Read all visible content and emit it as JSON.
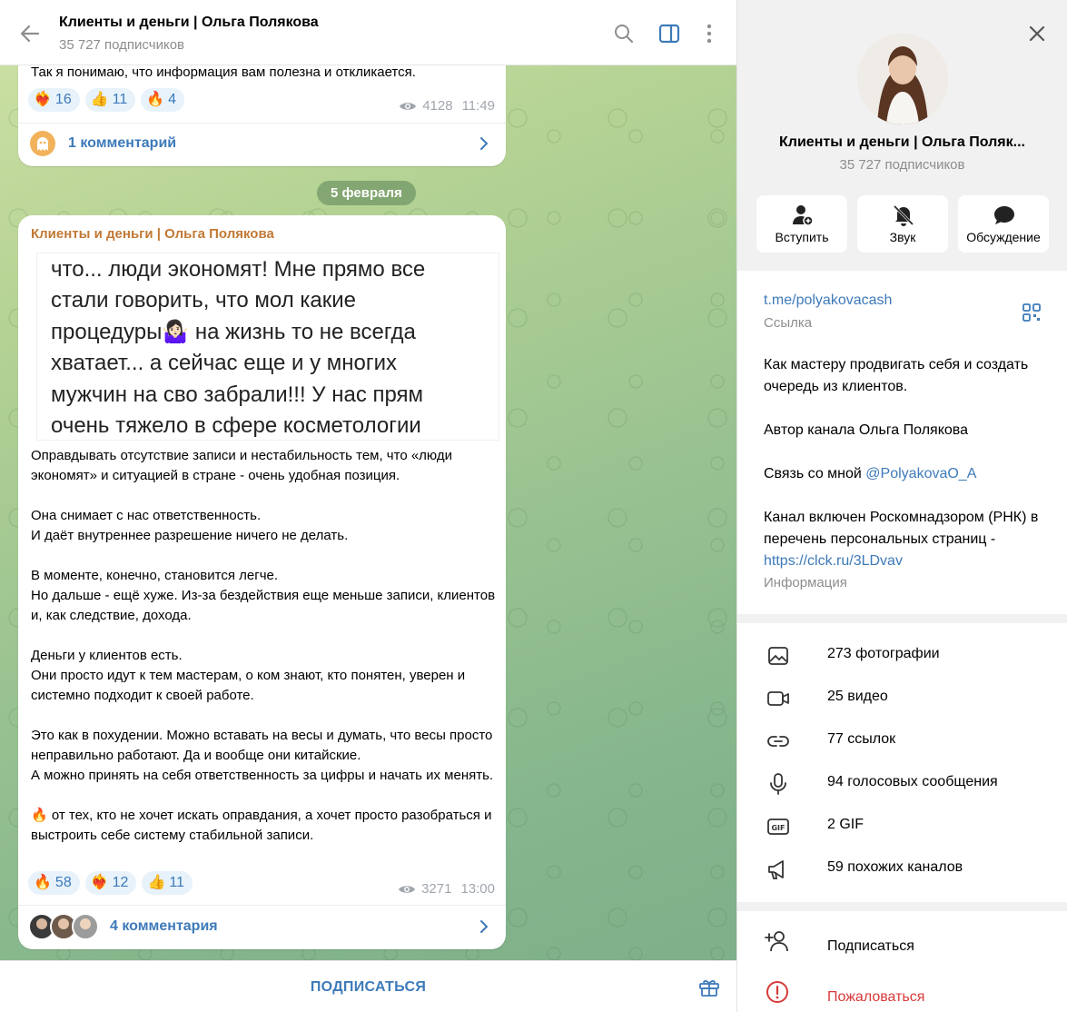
{
  "chat": {
    "header": {
      "title": "Клиенты и деньги | Ольга Полякова",
      "subtitle": "35 727 подписчиков"
    },
    "msg1": {
      "text_tail": "Так я понимаю, что информация вам полезна и откликается.",
      "reactions": [
        {
          "emoji": "❤️‍🔥",
          "count": "16"
        },
        {
          "emoji": "👍",
          "count": "11"
        },
        {
          "emoji": "🔥",
          "count": "4"
        }
      ],
      "views": "4128",
      "time": "11:49",
      "comments_label": "1 комментарий"
    },
    "date_chip": "5 февраля",
    "msg2": {
      "sender": "Клиенты и деньги | Ольга Полякова",
      "image_quote": "что... люди экономят! Мне прямо все\nстали говорить, что мол какие\nпроцедуры🤷🏻‍♀️ на жизнь то не всегда\nхватает... а сейчас еще и у многих\nмужчин на сво забрали!!! У нас прям\nочень тяжело в сфере косметологии",
      "text": "Оправдывать отсутствие записи и нестабильность тем, что «люди экономят» и ситуацией в стране - очень удобная позиция.\n\nОна снимает с нас ответственность.\nИ даёт внутреннее разрешение ничего не делать.\n\nВ моменте, конечно, становится легче.\nНо дальше - ещё хуже. Из-за бездействия еще меньше записи, клиентов и, как следствие, дохода.\n\nДеньги у клиентов есть.\nОни просто идут к тем мастерам, о ком знают, кто понятен, уверен и системно подходит к своей работе.\n\nЭто как в похудении. Можно вставать на весы и думать, что весы просто неправильно работают. Да и вообще они китайские.\nА можно принять на себя ответственность за цифры и начать их менять.\n\n🔥 от тех, кто не хочет искать оправдания, а хочет просто разобраться и выстроить себе систему стабильной записи.",
      "reactions": [
        {
          "emoji": "🔥",
          "count": "58"
        },
        {
          "emoji": "❤️‍🔥",
          "count": "12"
        },
        {
          "emoji": "👍",
          "count": "11"
        }
      ],
      "views": "3271",
      "time": "13:00",
      "comments_label": "4 комментария"
    },
    "subscribe_label": "ПОДПИСАТЬСЯ"
  },
  "panel": {
    "title": "Клиенты и деньги | Ольга Поляк...",
    "subtitle": "35 727 подписчиков",
    "actions": [
      {
        "label": "Вступить",
        "icon": "add-user-icon"
      },
      {
        "label": "Звук",
        "icon": "bell-off-icon"
      },
      {
        "label": "Обсуждение",
        "icon": "chat-bubble-icon"
      }
    ],
    "link": "t.me/polyakovacash",
    "link_caption": "Ссылка",
    "about_line1": "Как мастеру продвигать себя и создать очередь из клиентов.",
    "about_line2": "Автор канала Ольга Полякова",
    "contact_prefix": "Связь со мной ",
    "contact_handle": "@PolyakovaO_A",
    "rkn_text": "Канал включен Роскомнадзором (РНК) в перечень персональных страниц - ",
    "rkn_link": "https://clck.ru/3LDvav",
    "info_caption": "Информация",
    "media": [
      {
        "label": "273 фотографии",
        "icon": "photo-icon"
      },
      {
        "label": "25 видео",
        "icon": "video-icon"
      },
      {
        "label": "77 ссылок",
        "icon": "link-icon"
      },
      {
        "label": "94 голосовых сообщения",
        "icon": "microphone-icon"
      },
      {
        "label": "2 GIF",
        "icon": "gif-icon"
      },
      {
        "label": "59 похожих каналов",
        "icon": "megaphone-icon"
      }
    ],
    "subscribe_label": "Подписаться",
    "report_label": "Пожаловаться",
    "colors": {
      "accent": "#3d7ab9",
      "danger": "#d83a3a",
      "sender": "#c27935"
    }
  }
}
